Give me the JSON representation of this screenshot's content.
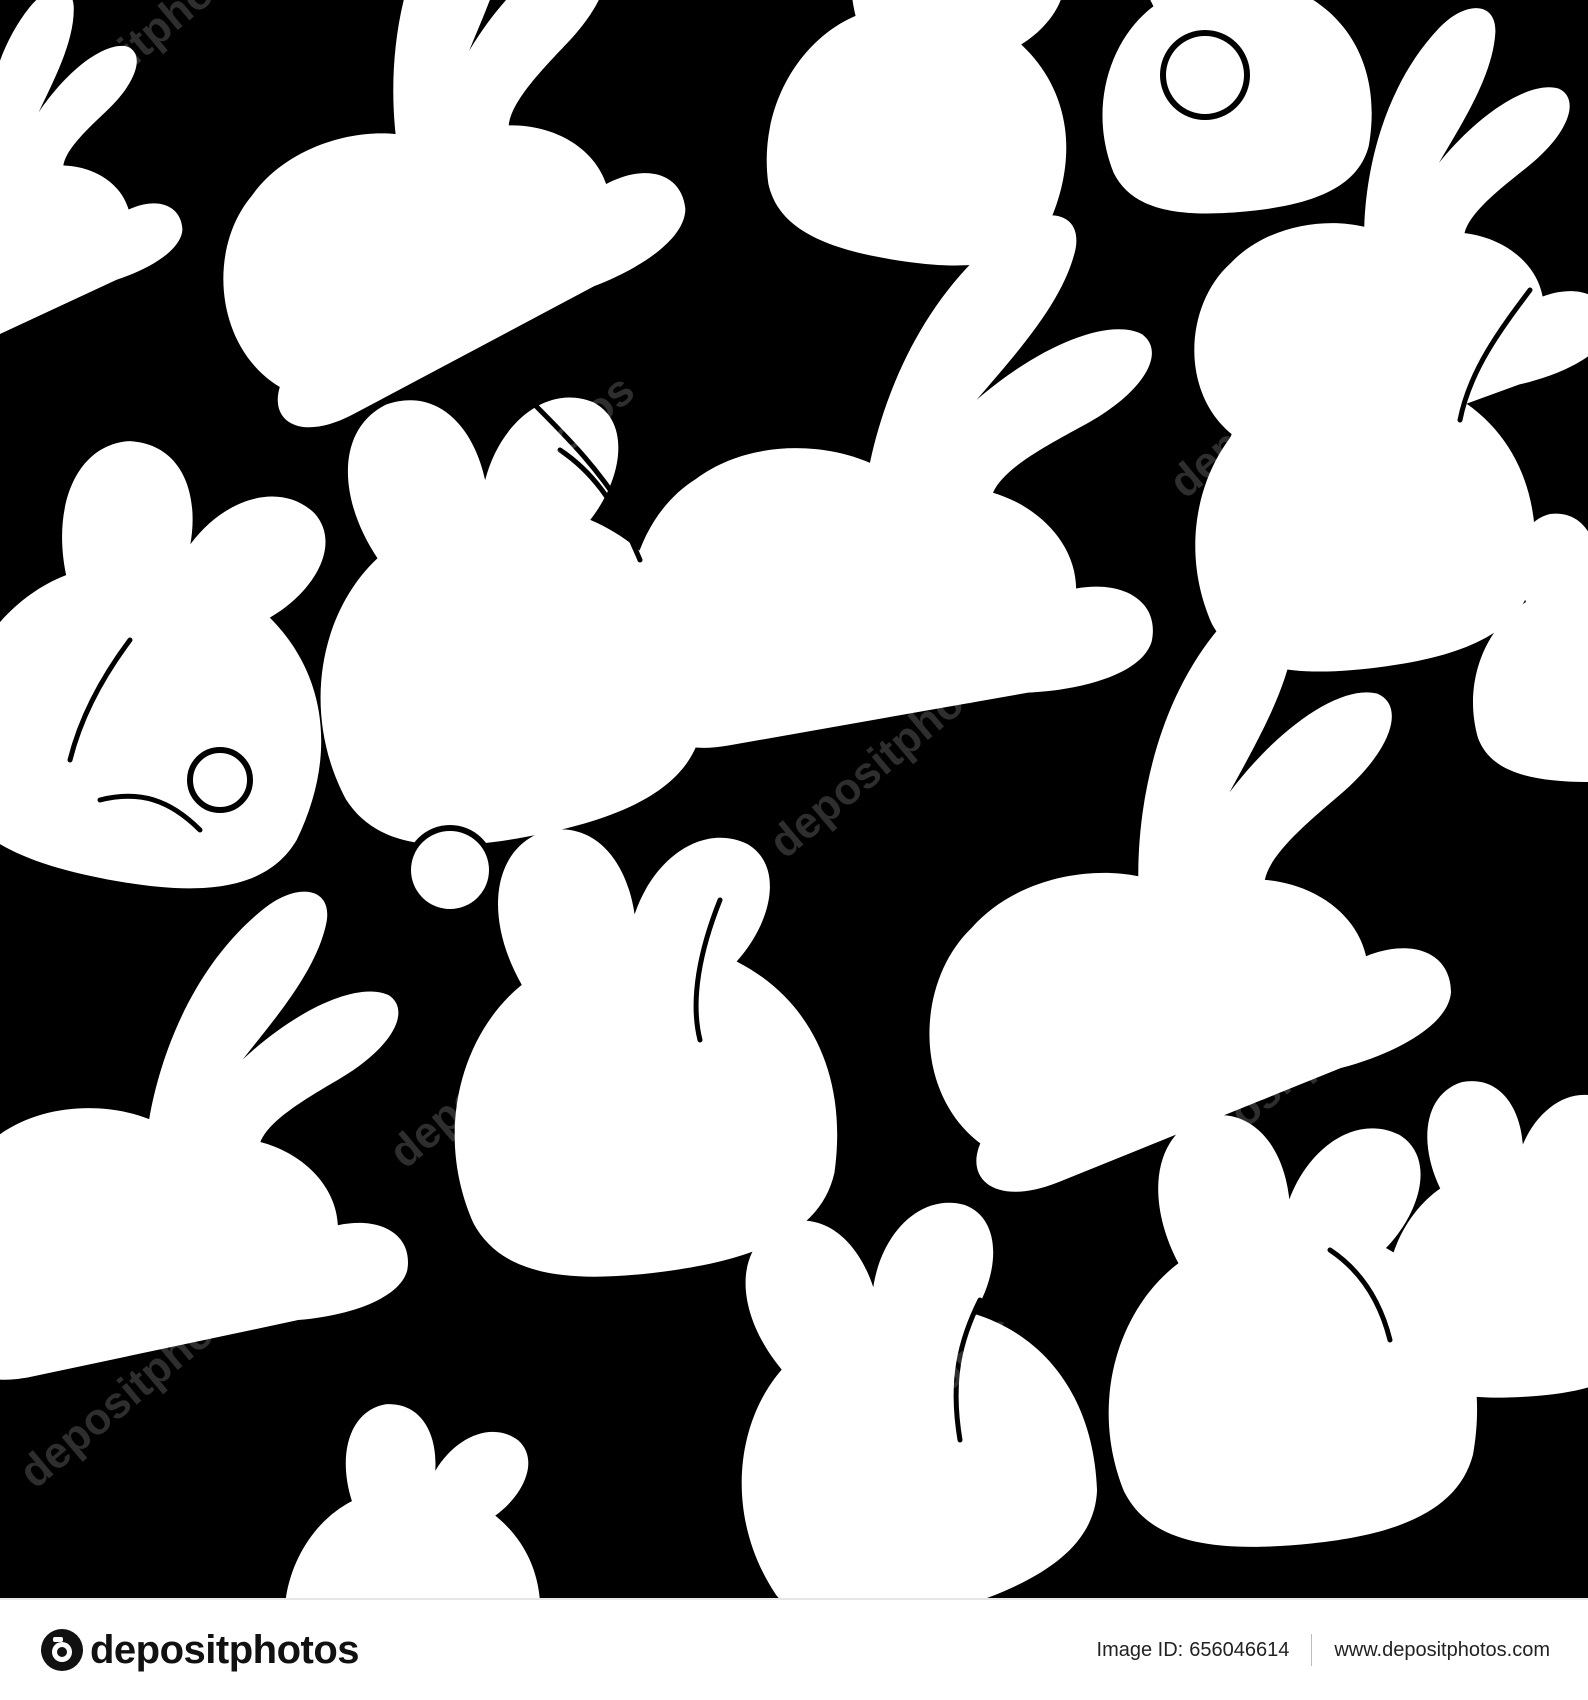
{
  "pattern": {
    "background_color": "#000000",
    "shape_color": "#ffffff",
    "subject": "rabbit silhouettes"
  },
  "watermark": {
    "text": "depositphotos"
  },
  "footer": {
    "logo_text": "depositphotos",
    "image_id_label": "Image ID:",
    "image_id_value": "656046614",
    "website": "www.depositphotos.com"
  }
}
